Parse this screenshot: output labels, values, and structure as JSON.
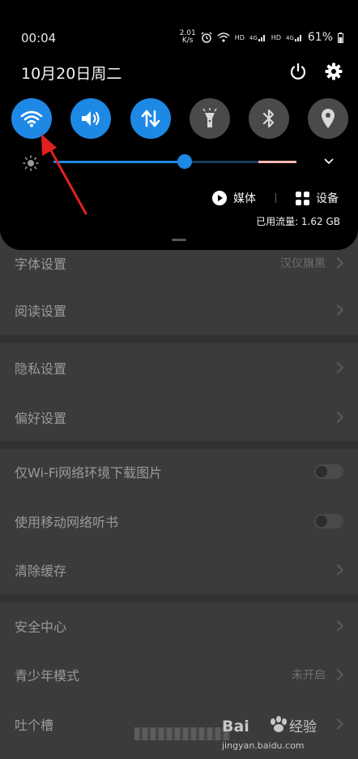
{
  "status_bar": {
    "time": "00:04",
    "net_speed_value": "2.01",
    "net_speed_unit": "K/s",
    "hd1": "HD",
    "net1": "4G",
    "hd2": "HD",
    "net2": "4G",
    "battery": "61%"
  },
  "date": "10月20日周二",
  "quick_tiles": [
    "wifi",
    "sound",
    "mobile-data",
    "flashlight",
    "bluetooth",
    "location"
  ],
  "brightness": {
    "level": 0.54
  },
  "media_label": "媒体",
  "devices_label": "设备",
  "data_usage": "已用流量: 1.62 GB",
  "settings": {
    "font": {
      "label": "字体设置",
      "value": "汉仪旗黑"
    },
    "reading": "阅读设置",
    "privacy": "隐私设置",
    "preference": "偏好设置",
    "wifi_images": "仅Wi-Fi网络环境下载图片",
    "mobile_listen": "使用移动网络听书",
    "clear_cache": "清除缓存",
    "security": "安全中心",
    "teen": {
      "label": "青少年模式",
      "value": "未开启"
    },
    "feedback": "吐个槽"
  },
  "watermark": {
    "brand": "Bai",
    "suffix": "经验",
    "url": "jingyan.baidu.com"
  }
}
